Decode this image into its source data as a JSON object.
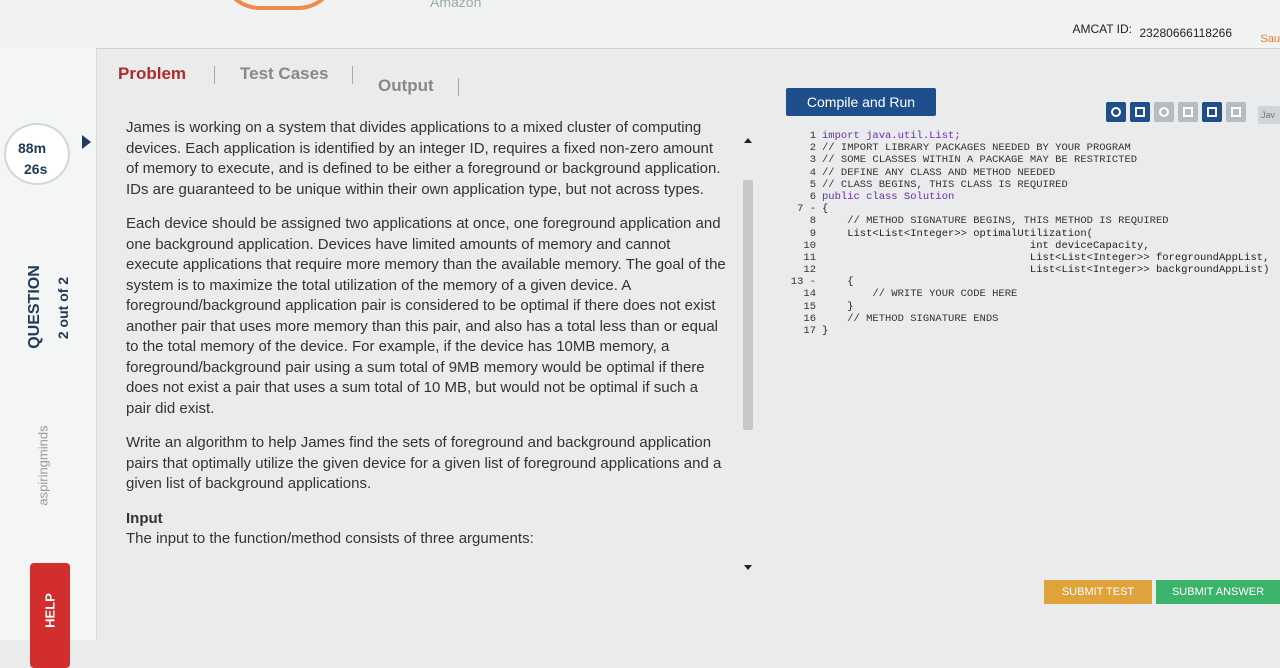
{
  "header": {
    "brand_text": "Amazon",
    "amcat_label": "AMCAT ID:",
    "amcat_id": "23280666118266",
    "user": "Sau"
  },
  "sidebar": {
    "timer_minutes": "88m",
    "timer_seconds": "26s",
    "question_label": "QUESTION",
    "question_count": "2 out of 2",
    "watermark": "aspiringminds",
    "help_label": "HELP"
  },
  "tabs": [
    "Problem",
    "Test Cases",
    "Output"
  ],
  "problem": {
    "para1": "James is working on a system that divides applications to a mixed cluster of computing devices. Each application is identified by an integer ID, requires a fixed non-zero amount of memory to execute, and is defined to be either a foreground or background application. IDs are guaranteed to be unique within their own application type, but not across types.",
    "para2": "Each device should be assigned two applications at once, one foreground application and one background application. Devices have limited amounts of memory and cannot execute applications that require more memory than the available memory. The goal of the system is to maximize the total utilization of the memory of a given device. A foreground/background application pair is considered to be optimal if there does not exist another pair that uses more memory than this pair, and also has a total less than or equal to the total memory of the device. For example, if the device has 10MB memory, a foreground/background pair using a sum total of 9MB memory would be optimal if there does not exist a pair that uses a sum total of 10 MB, but would not be optimal if such a pair did exist.",
    "para3": "Write an algorithm to help James find the sets of foreground and background application pairs that optimally utilize the given device for a given list of foreground applications and a given list of background applications.",
    "input_heading": "Input",
    "input_text": "The input to the function/method consists of three arguments:"
  },
  "editor": {
    "run_label": "Compile and Run",
    "lang": "Jav",
    "line_numbers": [
      "1",
      "2",
      "3",
      "4",
      "5",
      "6",
      "7 -",
      "8",
      "9",
      "10",
      "11",
      "12",
      "13 -",
      "14",
      "15",
      "16",
      "17"
    ],
    "lines": [
      "import java.util.List;",
      "// IMPORT LIBRARY PACKAGES NEEDED BY YOUR PROGRAM",
      "// SOME CLASSES WITHIN A PACKAGE MAY BE RESTRICTED",
      "// DEFINE ANY CLASS AND METHOD NEEDED",
      "// CLASS BEGINS, THIS CLASS IS REQUIRED",
      "public class Solution",
      "{",
      "    // METHOD SIGNATURE BEGINS, THIS METHOD IS REQUIRED",
      "    List<List<Integer>> optimalUtilization(",
      "                                 int deviceCapacity,",
      "                                 List<List<Integer>> foregroundAppList,",
      "                                 List<List<Integer>> backgroundAppList)",
      "    {",
      "        // WRITE YOUR CODE HERE",
      "    }",
      "    // METHOD SIGNATURE ENDS",
      "}"
    ]
  },
  "footer": {
    "submit_test": "SUBMIT TEST",
    "submit_answer": "SUBMIT ANSWER"
  }
}
